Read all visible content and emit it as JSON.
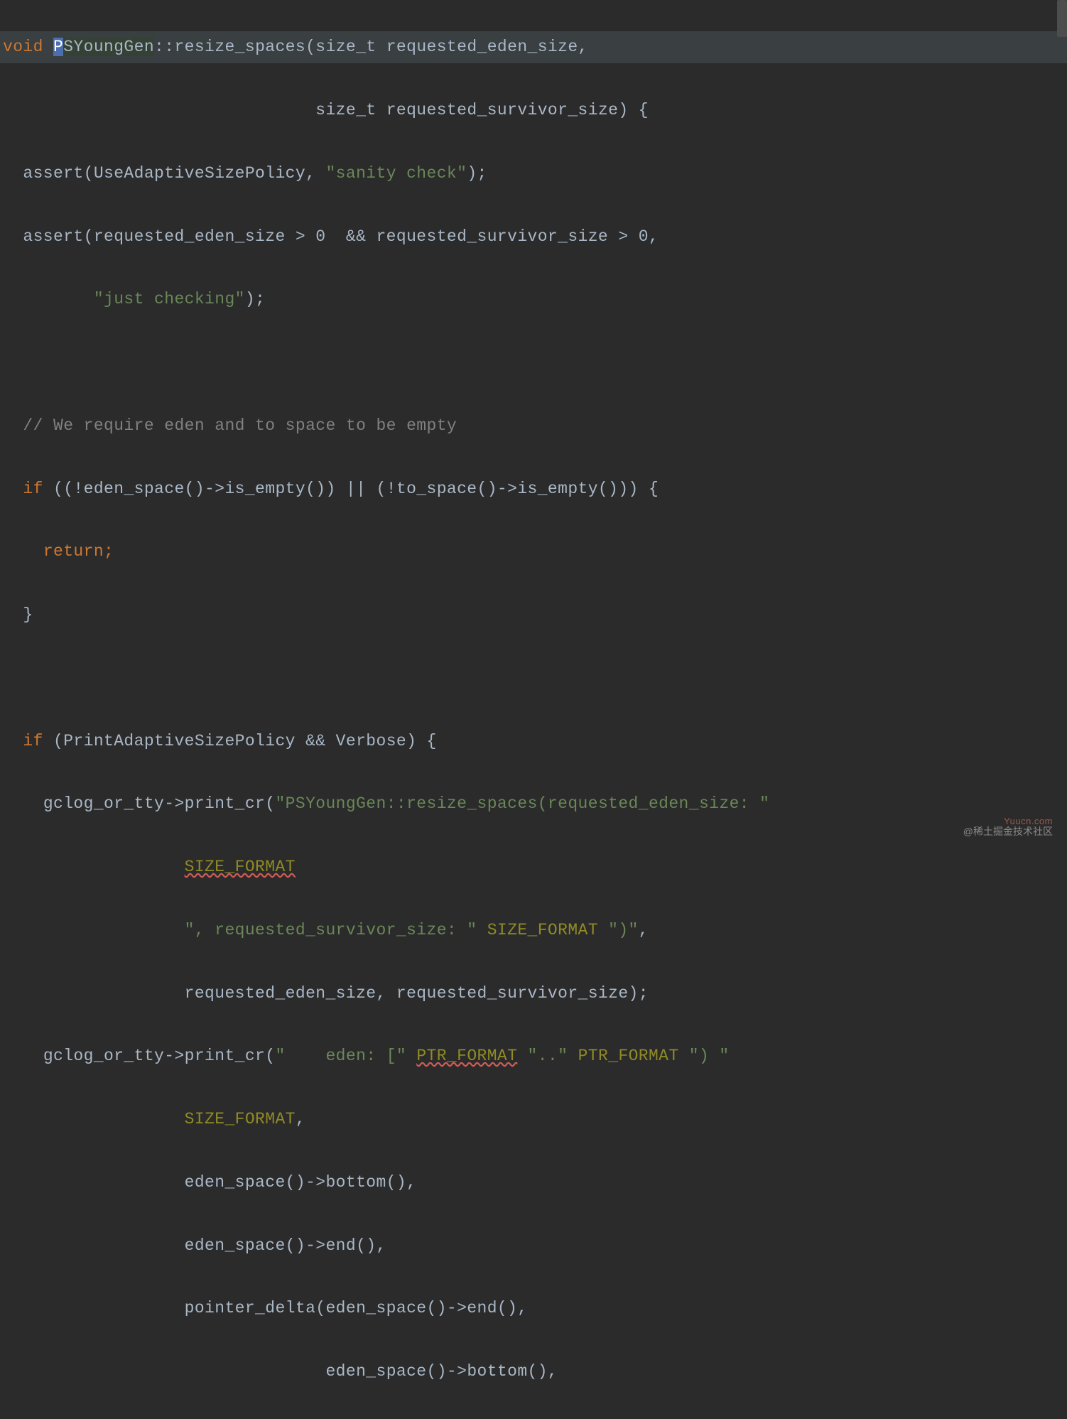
{
  "code": {
    "l0": {
      "kw_void": "void",
      "class_sel": "P",
      "class_rest": "SYoungGen",
      "scope": "::",
      "method": "resize_spaces",
      "args1": "(size_t requested_eden_size,"
    },
    "l1": {
      "indent": "                               ",
      "args2": "size_t requested_survivor_size) {"
    },
    "l2": {
      "indent": "  ",
      "call": "assert(UseAdaptiveSizePolicy, ",
      "str": "\"sanity check\"",
      "tail": ");"
    },
    "l3": {
      "indent": "  ",
      "call": "assert(requested_eden_size > 0  && requested_survivor_size > 0,"
    },
    "l4": {
      "indent": "         ",
      "str": "\"just checking\"",
      "tail": ");"
    },
    "l5": "",
    "l6": {
      "indent": "  ",
      "comment": "// We require eden and to space to be empty"
    },
    "l7": {
      "indent": "  ",
      "kw_if": "if",
      "cond": " ((!eden_space()->is_empty()) || (!to_space()->is_empty())) {"
    },
    "l8": {
      "indent": "    ",
      "kw_return": "return",
      "tail": ";"
    },
    "l9": {
      "indent": "  ",
      "brace": "}"
    },
    "l10": "",
    "l11": {
      "indent": "  ",
      "kw_if": "if",
      "cond": " (PrintAdaptiveSizePolicy && Verbose) {"
    },
    "l12": {
      "indent": "    ",
      "call": "gclog_or_tty->print_cr(",
      "str": "\"PSYoungGen::resize_spaces(requested_eden_size: \""
    },
    "l13": {
      "indent": "                  ",
      "macro": "SIZE_FORMAT"
    },
    "l14": {
      "indent": "                  ",
      "str1": "\", requested_survivor_size: \"",
      "sp1": " ",
      "macro": "SIZE_FORMAT",
      "sp2": " ",
      "str2": "\")\"",
      "tail": ","
    },
    "l15": {
      "indent": "                  ",
      "args": "requested_eden_size, requested_survivor_size);"
    },
    "l16": {
      "indent": "    ",
      "call": "gclog_or_tty->print_cr(",
      "str1": "\"    eden: [\"",
      "sp1": " ",
      "macro1": "PTR_FORMAT",
      "sp2": " ",
      "str2": "\"..\"",
      "sp3": " ",
      "macro2": "PTR_FORMAT",
      "sp4": " ",
      "str3": "\") \""
    },
    "l17": {
      "indent": "                  ",
      "macro": "SIZE_FORMAT",
      "tail": ","
    },
    "l18": {
      "indent": "                  ",
      "call": "eden_space()->bottom(),"
    },
    "l19": {
      "indent": "                  ",
      "call": "eden_space()->end(),"
    },
    "l20": {
      "indent": "                  ",
      "call": "pointer_delta(eden_space()->end(),"
    },
    "l21": {
      "indent": "                                ",
      "call": "eden_space()->bottom(),"
    }
  },
  "watermark1": "@稀土掘金技术社区",
  "watermark2": "Yuucn.com"
}
